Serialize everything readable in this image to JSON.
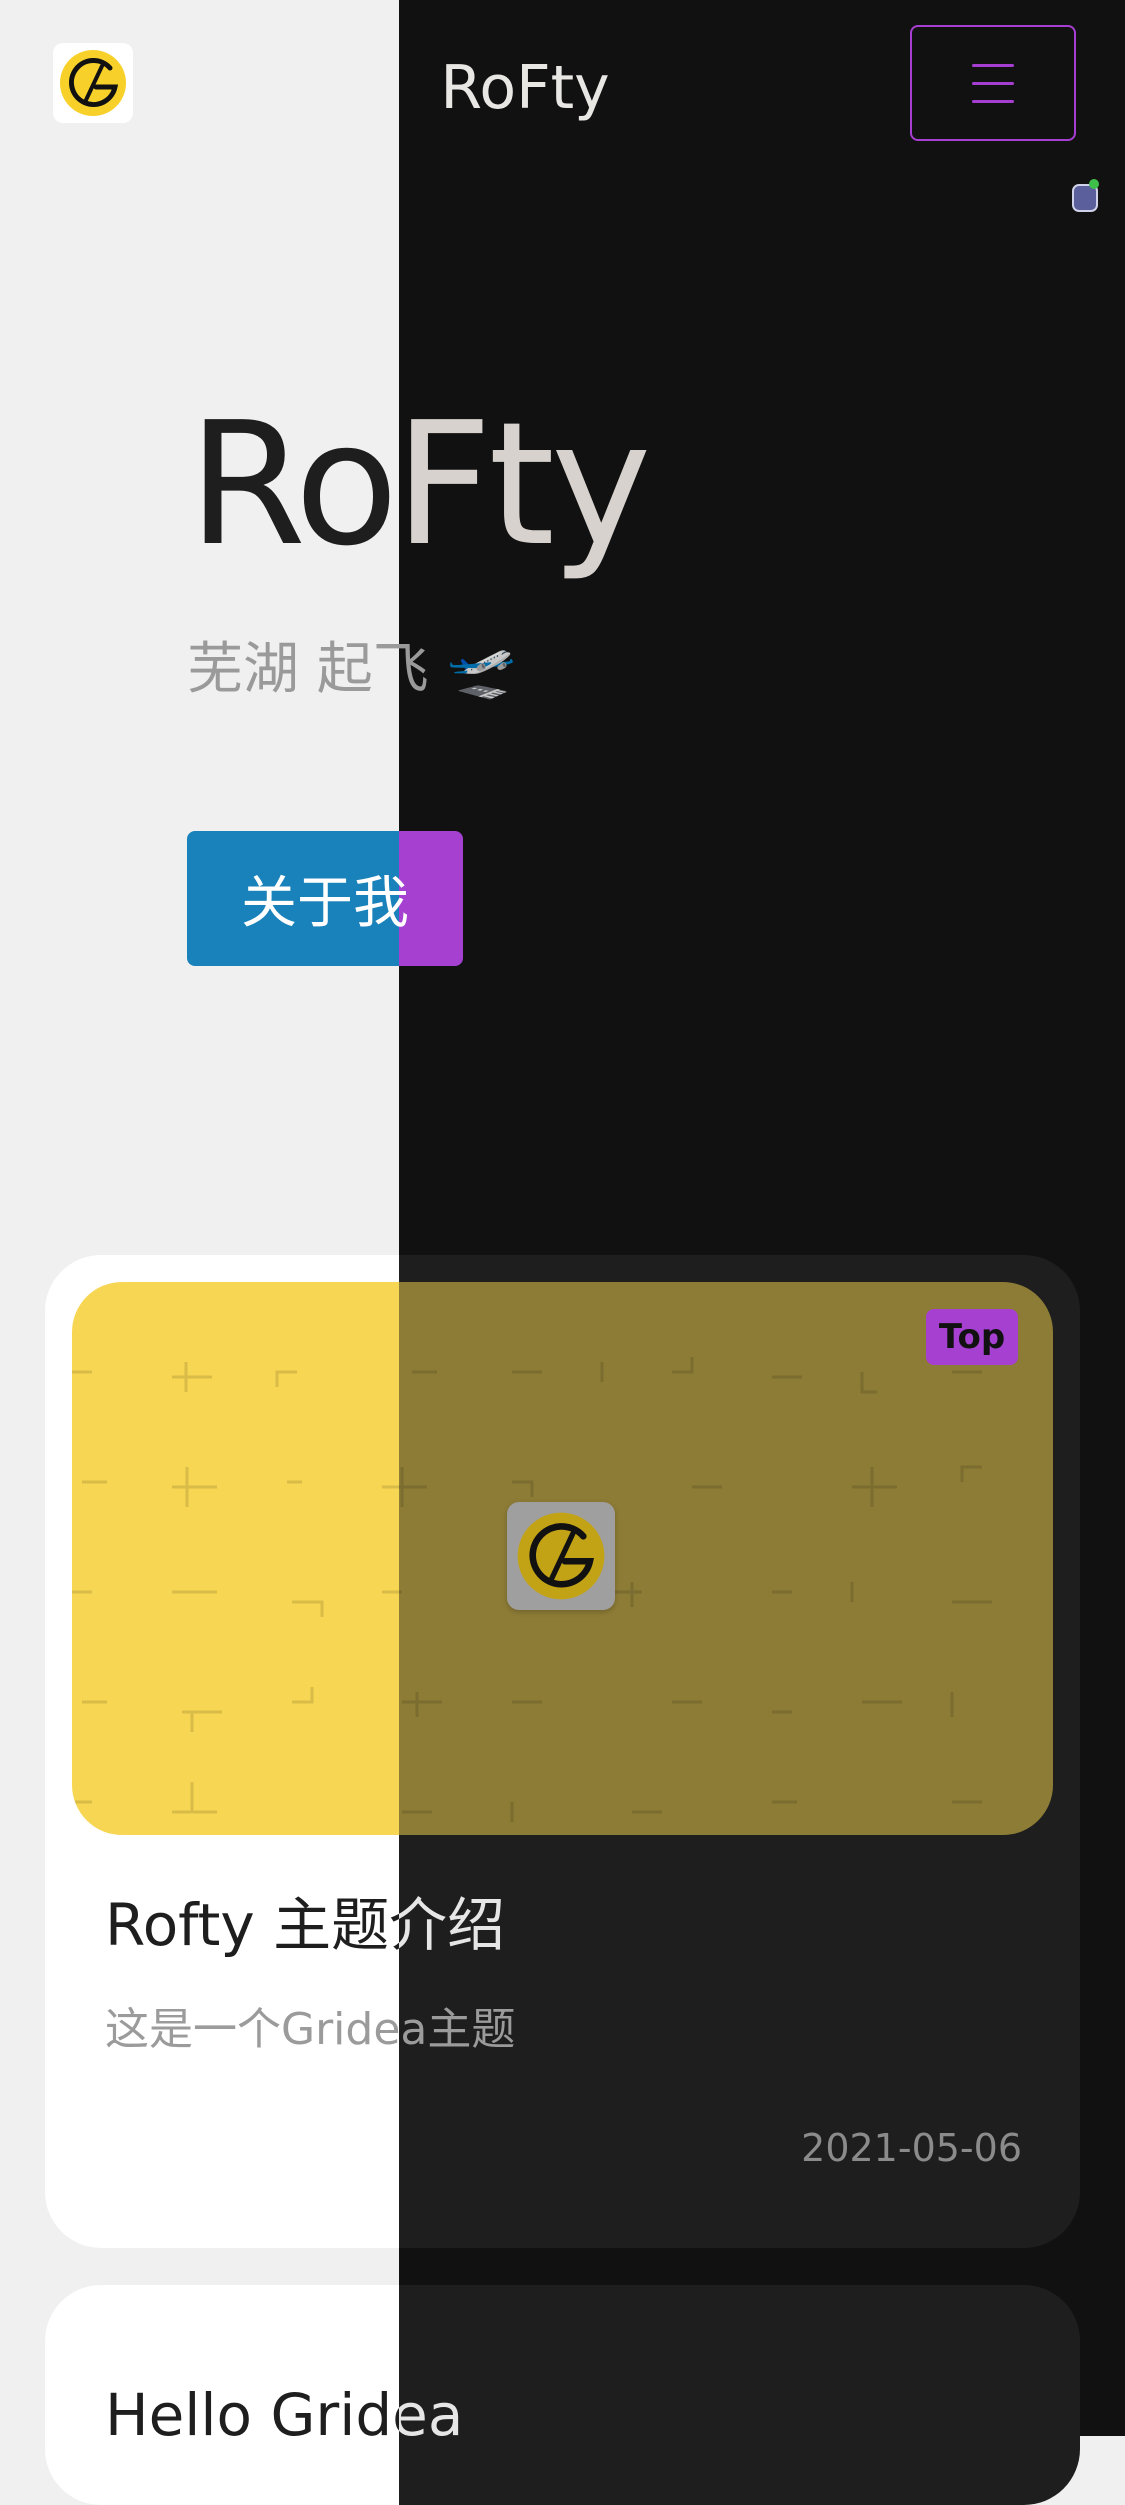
{
  "header": {
    "title": "RoFty",
    "logo_icon": "gridea-logo-icon",
    "menu_icon": "hamburger-menu-icon"
  },
  "hero": {
    "title": "RoFty",
    "subtitle": "芜湖 起飞 🛫",
    "about_label": "关于我"
  },
  "posts": [
    {
      "cover_icon": "gridea-logo-icon",
      "badge": "Top",
      "title": "Rofty 主题介绍",
      "description": "这是一个Gridea主题",
      "date": "2021-05-06"
    },
    {
      "title": "Hello Gridea"
    }
  ],
  "colors": {
    "light_bg": "#f0f0f0",
    "dark_bg": "#111111",
    "accent_purple": "#a540d0",
    "accent_blue": "#1a82ba",
    "cover_yellow": "#f7d653"
  }
}
